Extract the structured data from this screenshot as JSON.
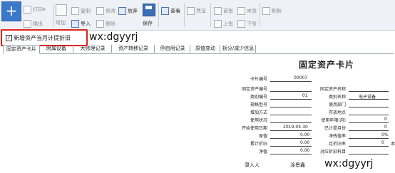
{
  "toolbar": {
    "add_symbol": "+",
    "print_label": "打印",
    "print_arrow": "▾",
    "export_label": "输出",
    "add_label": "增加",
    "copy_label": "复制",
    "modify_label": "修改",
    "discard_label": "放弃",
    "import_label": "导入",
    "delete_label": "删除",
    "save_label": "保存",
    "view_label": "查看",
    "voucher_label": "凭证",
    "first_label": "首张",
    "last_label": "末张",
    "prev_label": "上张",
    "next_label": "下张",
    "refresh_label": "刷新"
  },
  "checkbox": {
    "checked_mark": "✓",
    "label": "新增资产当月计提折旧"
  },
  "watermark": {
    "top": "wx:dgyyrj",
    "bottom": "wx:dgyyrj"
  },
  "tabs": [
    {
      "label": "固定资产卡片"
    },
    {
      "label": "附属设备"
    },
    {
      "label": "大修理记录"
    },
    {
      "label": "资产转移记录"
    },
    {
      "label": "停启用记录"
    },
    {
      "label": "原值变动"
    },
    {
      "label": "拆分/减少信息"
    }
  ],
  "card": {
    "title": "固定资产卡片",
    "card_no_label": "卡片编号",
    "card_no_value": "00007",
    "left_fields": [
      {
        "label": "固定资产编号",
        "value": ""
      },
      {
        "label": "类别编号",
        "value": "01"
      },
      {
        "label": "规格型号",
        "value": ""
      },
      {
        "label": "增加方式",
        "value": ""
      },
      {
        "label": "使用状况",
        "value": ""
      },
      {
        "label": "开始使用日期",
        "value": "2019-04-30"
      },
      {
        "label": "原值",
        "value": "0.00"
      },
      {
        "label": "累计折旧",
        "value": "0.00"
      },
      {
        "label": "净值",
        "value": "0.00"
      }
    ],
    "right_fields": [
      {
        "label": "固定资产名称",
        "value": ""
      },
      {
        "label": "类别名称",
        "value": "电子设备"
      },
      {
        "label": "使用部门",
        "value": ""
      },
      {
        "label": "存放地点",
        "value": ""
      },
      {
        "label": "使用年限(月)",
        "value": "0"
      },
      {
        "label": "已计提月份",
        "value": "0"
      },
      {
        "label": "净残值率",
        "value": "0%"
      },
      {
        "label": "月折旧率",
        "value": "0"
      },
      {
        "label": "对应折旧科目",
        "value": ""
      }
    ],
    "extra_right_value": "本",
    "recorder_label": "录入人",
    "recorder_value": "涂景鑫"
  }
}
